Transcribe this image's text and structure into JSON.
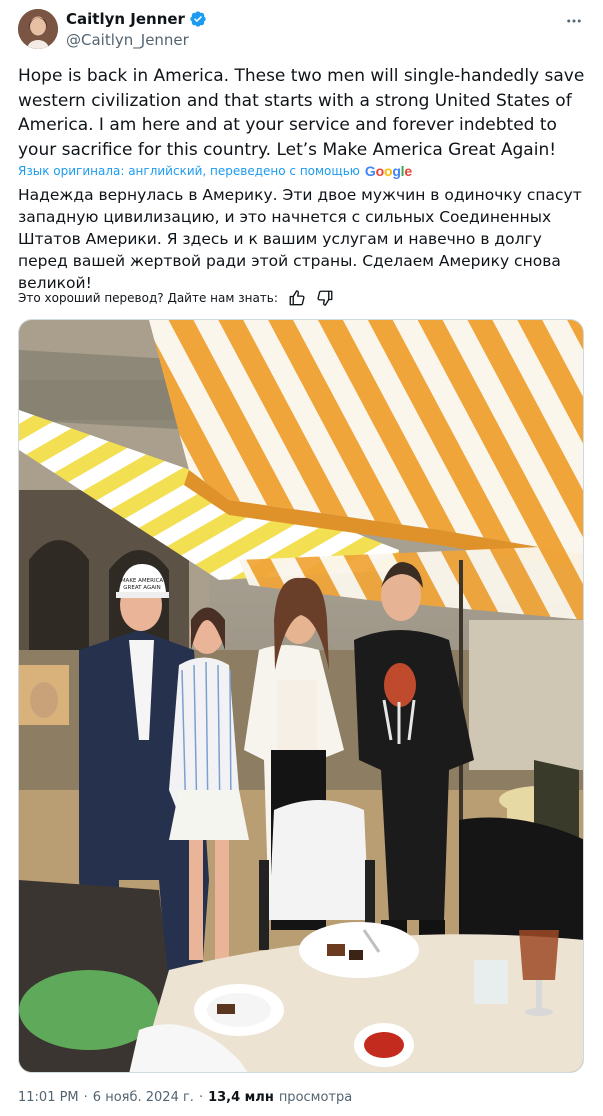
{
  "author": {
    "display_name": "Caitlyn Jenner",
    "handle": "@Caitlyn_Jenner",
    "verified": true
  },
  "icons": {
    "verified": "verified-badge-icon",
    "more": "more-options-icon",
    "like_feedback": "thumbs-up-icon",
    "dislike_feedback": "thumbs-down-icon"
  },
  "tweet": {
    "text": "Hope is back in America. These two men will single-handedly save western civilization and that starts with a strong United States of America. I am here and at your service and forever indebted to your sacrifice for this country. Let’s Make America Great Again!",
    "translation_label": "Язык оригинала: английский, переведено с помощью",
    "translation_provider": "Google",
    "translated_text": "Надежда вернулась в Америку. Эти двое мужчин в одиночку спасут западную цивилизацию, и это начнется с сильных Соединенных Штатов Америки. Я здесь и к вашим услугам и навечно в долгу перед вашей жертвой ради этой страны. Сделаем Америку снова великой!",
    "feedback_prompt": "Это хороший перевод? Дайте нам знать:",
    "photo_hat_text": "MAKE AMERICA GREAT AGAIN"
  },
  "meta": {
    "time": "11:01 PM",
    "separator": "·",
    "date": "6 нояб. 2024 г.",
    "views_count": "13,4 млн",
    "views_label": "просмотра"
  },
  "colors": {
    "text_primary": "#0f1419",
    "text_secondary": "#536471",
    "verified_blue": "#1d9bf0",
    "link_blue": "#1d9bf0",
    "awning_orange": "#f0a53a",
    "awning_white": "#faf6ec",
    "awning_yellow": "#f3df52"
  }
}
